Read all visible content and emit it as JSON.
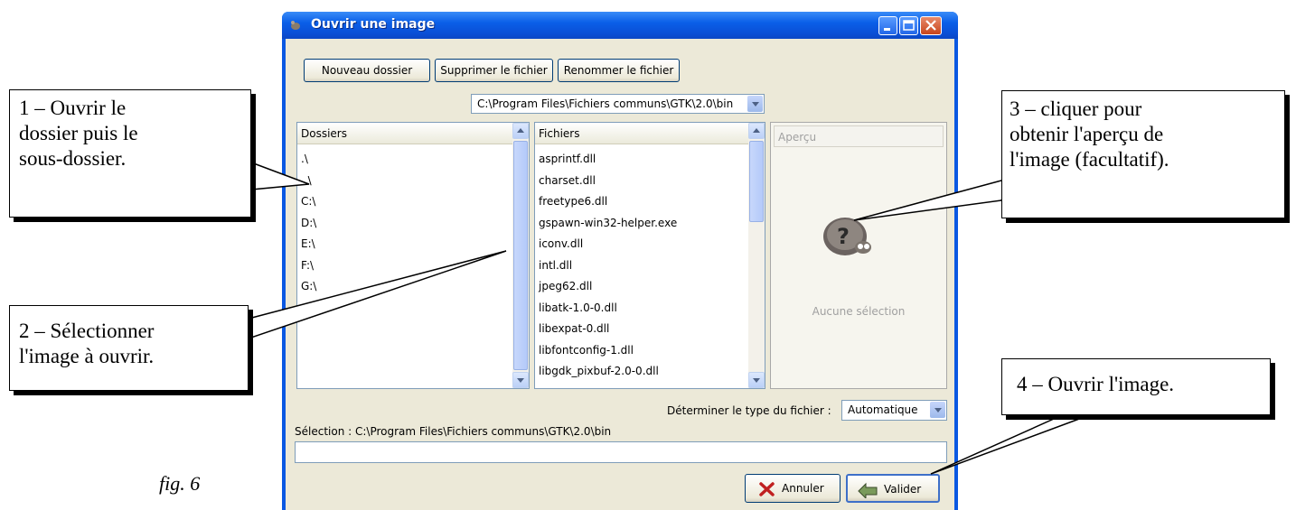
{
  "window": {
    "title": "Ouvrir une image",
    "controls": [
      "minimize",
      "maximize",
      "close"
    ]
  },
  "toolbar": {
    "new_folder": "Nouveau dossier",
    "delete_file": "Supprimer le fichier",
    "rename_file": "Renommer le fichier"
  },
  "path_combo": {
    "value": "C:\\Program Files\\Fichiers communs\\GTK\\2.0\\bin"
  },
  "folders": {
    "header": "Dossiers",
    "items": [
      ".\\",
      "..\\",
      "C:\\",
      "D:\\",
      "E:\\",
      "F:\\",
      "G:\\"
    ]
  },
  "files": {
    "header": "Fichiers",
    "items": [
      "asprintf.dll",
      "charset.dll",
      "freetype6.dll",
      "gspawn-win32-helper.exe",
      "iconv.dll",
      "intl.dll",
      "jpeg62.dll",
      "libatk-1.0-0.dll",
      "libexpat-0.dll",
      "libfontconfig-1.dll",
      "libgdk_pixbuf-2.0-0.dll"
    ]
  },
  "preview": {
    "header": "Aperçu",
    "empty_text": "Aucune sélection",
    "icon": "gimp-question-icon"
  },
  "filetype": {
    "label": "Déterminer le type du fichier :",
    "value": "Automatique"
  },
  "selection": {
    "label": "Sélection : C:\\Program Files\\Fichiers communs\\GTK\\2.0\\bin",
    "value": ""
  },
  "actions": {
    "cancel": "Annuler",
    "ok": "Valider"
  },
  "callouts": {
    "c1": [
      "1 – Ouvrir le",
      "dossier puis le",
      "sous-dossier."
    ],
    "c2": [
      "2 – Sélectionner",
      "l'image à ouvrir."
    ],
    "c3": [
      "3 – cliquer pour",
      "obtenir l'aperçu de",
      "l'image (facultatif)."
    ],
    "c4": [
      "4 – Ouvrir l'image."
    ]
  },
  "figure_label": "fig. 6",
  "colors": {
    "titlebar": "#0a5fe8",
    "dialog_bg": "#ece9d8",
    "scroll": "#c7d7fb",
    "close": "#c8451c"
  }
}
